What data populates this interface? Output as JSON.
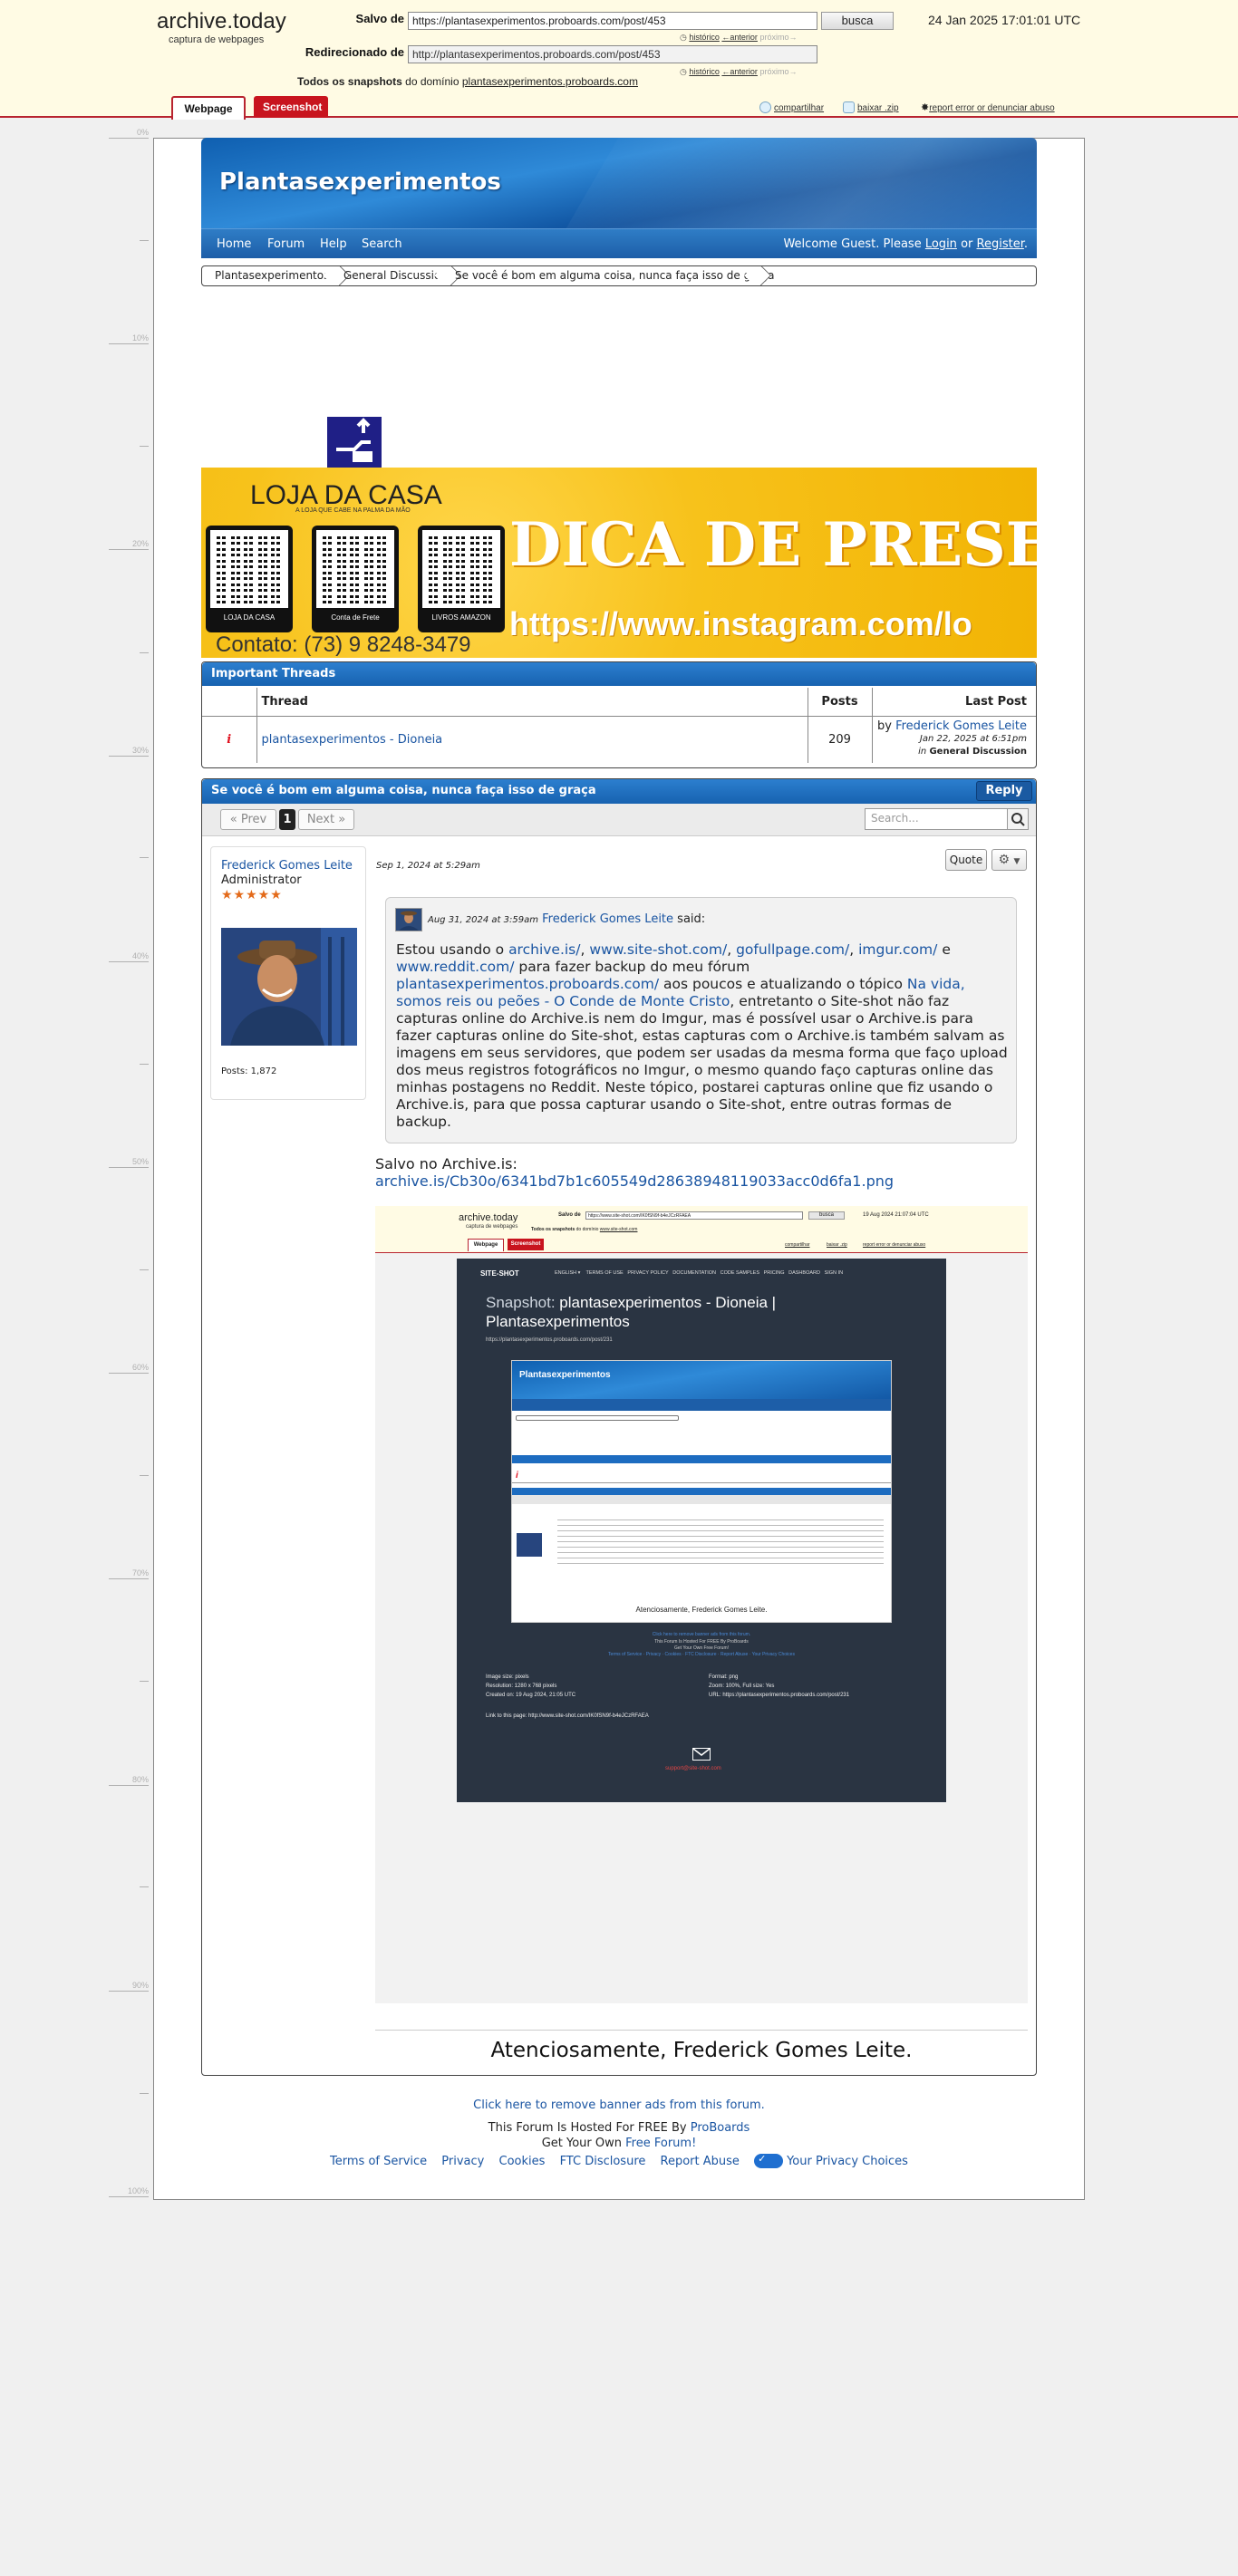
{
  "archive": {
    "logo": "archive.today",
    "subtitle": "captura de webpages",
    "saved_label": "Salvo de",
    "saved_url": "https://plantasexperimentos.proboards.com/post/453",
    "search_button": "busca",
    "date": "24 Jan 2025 17:01:01 UTC",
    "redirect_label": "Redirecionado de",
    "redirect_url": "http://plantasexperimentos.proboards.com/post/453",
    "all_snapshots_label": "Todos os snapshots",
    "domain_label": "do domínio",
    "domain_link": "plantasexperimentos.proboards.com",
    "history": "histórico",
    "previous": "←anterior",
    "next": "próximo→",
    "tab_webpage": "Webpage",
    "tab_screenshot": "Screenshot",
    "share": "compartilhar",
    "download": "baixar .zip",
    "report": "report error or denunciar abuso",
    "icons": {
      "share": "share-icon",
      "download": "download-icon",
      "report": "report-icon"
    }
  },
  "ruler": [
    "0%",
    "10%",
    "20%",
    "30%",
    "40%",
    "50%",
    "60%",
    "70%",
    "80%",
    "90%",
    "100%"
  ],
  "forum": {
    "title": "Plantasexperimentos",
    "nav": [
      "Home",
      "Forum",
      "Help",
      "Search"
    ],
    "welcome_prefix": "Welcome Guest. Please",
    "login": "Login",
    "or": "or",
    "register": "Register",
    "breadcrumb": [
      "Plantasexperimentos",
      "General Discussion",
      "Se você é bom em alguma coisa, nunca faça isso de graça"
    ]
  },
  "ad": {
    "brand": "LOJA DA CASA",
    "tagline": "A LOJA QUE CABE NA PALMA DA MÃO",
    "qr_captions": [
      "LOJA DA CASA",
      "Conta de Frete",
      "LIVROS AMAZON"
    ],
    "headline": "DICA DE PRESENTE",
    "url": "https://www.instagram.com/lo",
    "contact": "Contato: (73) 9 8248-3479"
  },
  "important": {
    "title": "Important Threads",
    "columns": [
      "Thread",
      "Posts",
      "Last Post"
    ],
    "row": {
      "title": "plantasexperimentos - Dioneia",
      "posts": "209",
      "by": "by",
      "author": "Frederick Gomes Leite",
      "date": "Jan 22, 2025 at 6:51pm",
      "in": "in",
      "board": "General Discussion"
    }
  },
  "thread": {
    "title": "Se você é bom em alguma coisa, nunca faça isso de graça",
    "reply": "Reply",
    "prev": "« Prev",
    "page": "1",
    "next": "Next »",
    "search_placeholder": "Search..."
  },
  "post": {
    "user": "Frederick Gomes Leite",
    "role": "Administrator",
    "stars": "★★★★★",
    "posts": "Posts: 1,872",
    "date": "Sep 1, 2024 at 5:29am",
    "quote_button": "Quote",
    "quote": {
      "date": "Aug 31, 2024 at 3:59am",
      "author": "Frederick Gomes Leite",
      "said": "said:",
      "t1": "Estou usando o ",
      "l1": "archive.is/",
      "c1": ", ",
      "l2": "www.site-shot.com/",
      "c2": ", ",
      "l3": "gofullpage.com/",
      "c3": ", ",
      "l4": "imgur.com/",
      "t2": " e ",
      "l5": "www.reddit.com/",
      "t3": " para fazer backup do meu fórum ",
      "l6": "plantasexperimentos.proboards.com/",
      "t4": " aos poucos e atualizando o tópico ",
      "l7": "Na vida, somos reis ou peões - O Conde de Monte Cristo",
      "t5": ", entretanto o Site-shot não faz capturas online do Archive.is nem do Imgur, mas é possível usar o Archive.is para fazer capturas online do Site-shot, estas capturas com o Archive.is também salvam as imagens em seus servidores, que podem ser usadas da mesma forma que faço upload dos meus registros fotográficos no Imgur, o mesmo quando faço capturas online das minhas postagens no Reddit. Neste tópico, postarei capturas online que fiz usando o Archive.is, para que possa capturar usando o Site-shot, entre outras formas de backup."
    },
    "saved_label": "Salvo no Archive.is:",
    "saved_link": "archive.is/Cb30o/6341bd7b1c605549d28638948119033acc0d6fa1.png",
    "signature": "Atenciosamente, Frederick Gomes Leite."
  },
  "embedded": {
    "logo": "archive.today",
    "sub": "captura de webpages",
    "saved": "Salvo de",
    "url": "https://www.site-shot.com/IK0fSN9f-b4eJCzRFAEA",
    "busca": "busca",
    "date": "19 Aug 2024 21:07:04 UTC",
    "all": "Todos os snapshots",
    "domain_label": "do domínio",
    "domain": "www.site-shot.com",
    "tab_webpage": "Webpage",
    "tab_screenshot": "Screenshot",
    "share": "compartilhar",
    "download": "baixar .zip",
    "report": "report error or denunciar abuso",
    "ss_logo": "SITE-SHOT",
    "ss_nav": [
      "ENGLISH ▾",
      "TERMS OF USE",
      "PRIVACY POLICY",
      "DOCUMENTATION",
      "CODE SAMPLES",
      "PRICING",
      "DASHBOARD",
      "SIGN IN"
    ],
    "snapshot_prefix": "Snapshot:",
    "snapshot_title": "plantasexperimentos - Dioneia | Plantasexperimentos",
    "snapshot_url": "https://plantasexperimentos.proboards.com/post/231",
    "inner_title": "Plantasexperimentos",
    "inner_signature": "Atenciosamente, Frederick Gomes Leite.",
    "remove_ads": "Click here to remove banner ads from this forum.",
    "hosted": "This Forum Is Hosted For FREE By ProBoards",
    "free_forum": "Get Your Own Free Forum!",
    "footer_links": "Terms of Service · Privacy · Cookies · FTC Disclosure · Report Abuse · Your Privacy Choices",
    "image_size": "Image size: pixels",
    "resolution": "Resolution: 1280 x 768 pixels",
    "created": "Created on: 19 Aug 2024, 21:05 UTC",
    "format": "Format: png",
    "zoom": "Zoom: 100%, Full size: Yes",
    "url_info": "URL: https://plantasexperimentos.proboards.com/post/231",
    "link_to_page": "Link to this page: http://www.site-shot.com/IK0fSN9f-b4eJCzRFAEA",
    "support": "support@site-shot.com"
  },
  "footer": {
    "remove_ads": "Click here to remove banner ads from this forum.",
    "hosted_prefix": "This Forum Is Hosted For FREE By",
    "proboards": "ProBoards",
    "get_own": "Get Your Own",
    "free_forum": "Free Forum!",
    "links": [
      "Terms of Service",
      "Privacy",
      "Cookies",
      "FTC Disclosure",
      "Report Abuse",
      "Your Privacy Choices"
    ]
  }
}
